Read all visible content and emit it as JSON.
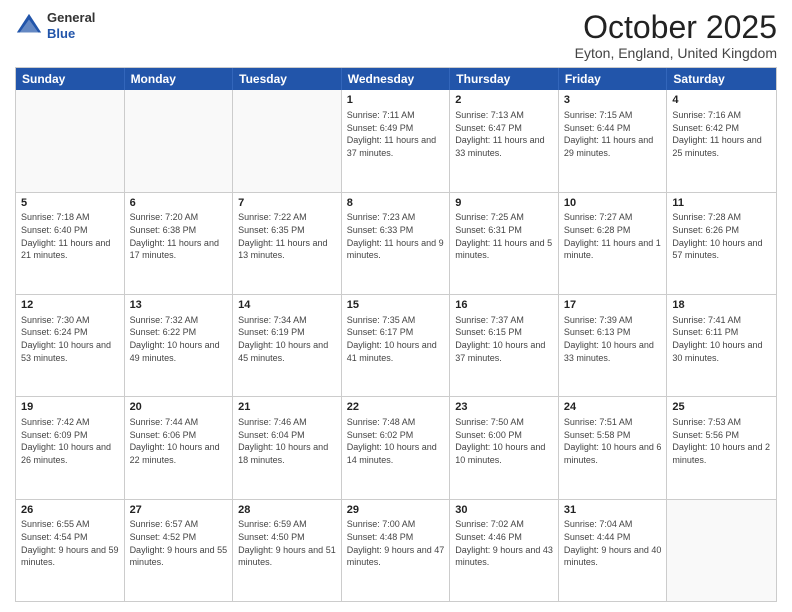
{
  "header": {
    "logo_line1": "General",
    "logo_line2": "Blue",
    "month": "October 2025",
    "location": "Eyton, England, United Kingdom"
  },
  "days_of_week": [
    "Sunday",
    "Monday",
    "Tuesday",
    "Wednesday",
    "Thursday",
    "Friday",
    "Saturday"
  ],
  "weeks": [
    [
      {
        "day": "",
        "empty": true
      },
      {
        "day": "",
        "empty": true
      },
      {
        "day": "",
        "empty": true
      },
      {
        "day": "1",
        "sunrise": "7:11 AM",
        "sunset": "6:49 PM",
        "daylight": "11 hours and 37 minutes."
      },
      {
        "day": "2",
        "sunrise": "7:13 AM",
        "sunset": "6:47 PM",
        "daylight": "11 hours and 33 minutes."
      },
      {
        "day": "3",
        "sunrise": "7:15 AM",
        "sunset": "6:44 PM",
        "daylight": "11 hours and 29 minutes."
      },
      {
        "day": "4",
        "sunrise": "7:16 AM",
        "sunset": "6:42 PM",
        "daylight": "11 hours and 25 minutes."
      }
    ],
    [
      {
        "day": "5",
        "sunrise": "7:18 AM",
        "sunset": "6:40 PM",
        "daylight": "11 hours and 21 minutes."
      },
      {
        "day": "6",
        "sunrise": "7:20 AM",
        "sunset": "6:38 PM",
        "daylight": "11 hours and 17 minutes."
      },
      {
        "day": "7",
        "sunrise": "7:22 AM",
        "sunset": "6:35 PM",
        "daylight": "11 hours and 13 minutes."
      },
      {
        "day": "8",
        "sunrise": "7:23 AM",
        "sunset": "6:33 PM",
        "daylight": "11 hours and 9 minutes."
      },
      {
        "day": "9",
        "sunrise": "7:25 AM",
        "sunset": "6:31 PM",
        "daylight": "11 hours and 5 minutes."
      },
      {
        "day": "10",
        "sunrise": "7:27 AM",
        "sunset": "6:28 PM",
        "daylight": "11 hours and 1 minute."
      },
      {
        "day": "11",
        "sunrise": "7:28 AM",
        "sunset": "6:26 PM",
        "daylight": "10 hours and 57 minutes."
      }
    ],
    [
      {
        "day": "12",
        "sunrise": "7:30 AM",
        "sunset": "6:24 PM",
        "daylight": "10 hours and 53 minutes."
      },
      {
        "day": "13",
        "sunrise": "7:32 AM",
        "sunset": "6:22 PM",
        "daylight": "10 hours and 49 minutes."
      },
      {
        "day": "14",
        "sunrise": "7:34 AM",
        "sunset": "6:19 PM",
        "daylight": "10 hours and 45 minutes."
      },
      {
        "day": "15",
        "sunrise": "7:35 AM",
        "sunset": "6:17 PM",
        "daylight": "10 hours and 41 minutes."
      },
      {
        "day": "16",
        "sunrise": "7:37 AM",
        "sunset": "6:15 PM",
        "daylight": "10 hours and 37 minutes."
      },
      {
        "day": "17",
        "sunrise": "7:39 AM",
        "sunset": "6:13 PM",
        "daylight": "10 hours and 33 minutes."
      },
      {
        "day": "18",
        "sunrise": "7:41 AM",
        "sunset": "6:11 PM",
        "daylight": "10 hours and 30 minutes."
      }
    ],
    [
      {
        "day": "19",
        "sunrise": "7:42 AM",
        "sunset": "6:09 PM",
        "daylight": "10 hours and 26 minutes."
      },
      {
        "day": "20",
        "sunrise": "7:44 AM",
        "sunset": "6:06 PM",
        "daylight": "10 hours and 22 minutes."
      },
      {
        "day": "21",
        "sunrise": "7:46 AM",
        "sunset": "6:04 PM",
        "daylight": "10 hours and 18 minutes."
      },
      {
        "day": "22",
        "sunrise": "7:48 AM",
        "sunset": "6:02 PM",
        "daylight": "10 hours and 14 minutes."
      },
      {
        "day": "23",
        "sunrise": "7:50 AM",
        "sunset": "6:00 PM",
        "daylight": "10 hours and 10 minutes."
      },
      {
        "day": "24",
        "sunrise": "7:51 AM",
        "sunset": "5:58 PM",
        "daylight": "10 hours and 6 minutes."
      },
      {
        "day": "25",
        "sunrise": "7:53 AM",
        "sunset": "5:56 PM",
        "daylight": "10 hours and 2 minutes."
      }
    ],
    [
      {
        "day": "26",
        "sunrise": "6:55 AM",
        "sunset": "4:54 PM",
        "daylight": "9 hours and 59 minutes."
      },
      {
        "day": "27",
        "sunrise": "6:57 AM",
        "sunset": "4:52 PM",
        "daylight": "9 hours and 55 minutes."
      },
      {
        "day": "28",
        "sunrise": "6:59 AM",
        "sunset": "4:50 PM",
        "daylight": "9 hours and 51 minutes."
      },
      {
        "day": "29",
        "sunrise": "7:00 AM",
        "sunset": "4:48 PM",
        "daylight": "9 hours and 47 minutes."
      },
      {
        "day": "30",
        "sunrise": "7:02 AM",
        "sunset": "4:46 PM",
        "daylight": "9 hours and 43 minutes."
      },
      {
        "day": "31",
        "sunrise": "7:04 AM",
        "sunset": "4:44 PM",
        "daylight": "9 hours and 40 minutes."
      },
      {
        "day": "",
        "empty": true
      }
    ]
  ]
}
